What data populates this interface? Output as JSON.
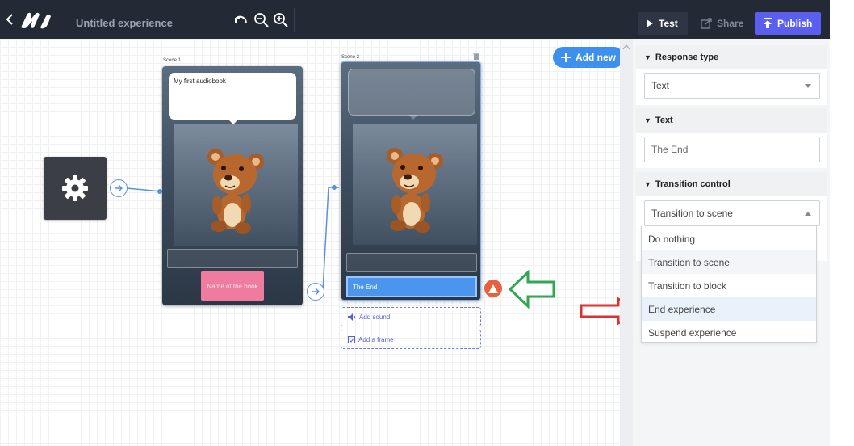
{
  "toolbar": {
    "title": "Untitled experience",
    "test_label": "Test",
    "share_label": "Share",
    "publish_label": "Publish"
  },
  "canvas": {
    "add_new_label": "Add new",
    "scene1": {
      "label": "Scene 1",
      "speech_text": "My first audiobook",
      "button_text": "Name of the book"
    },
    "scene2": {
      "label": "Scene 2",
      "button_text": "The End",
      "add_sound_label": "Add sound",
      "add_frame_label": "Add a frame"
    }
  },
  "panel": {
    "response_type": {
      "header": "Response type",
      "value": "Text"
    },
    "text": {
      "header": "Text",
      "value": "The End"
    },
    "transition": {
      "header": "Transition control",
      "selected": "Transition to scene",
      "options": [
        "Do nothing",
        "Transition to scene",
        "Transition to block",
        "End experience",
        "Suspend experience"
      ]
    }
  },
  "colors": {
    "topbar": "#242a35",
    "publish": "#5b5ff0",
    "accent_blue": "#3d8ff0",
    "pink_button": "#ef7b9e",
    "green_arrow": "#2fa84f",
    "red_arrow": "#e03030"
  }
}
